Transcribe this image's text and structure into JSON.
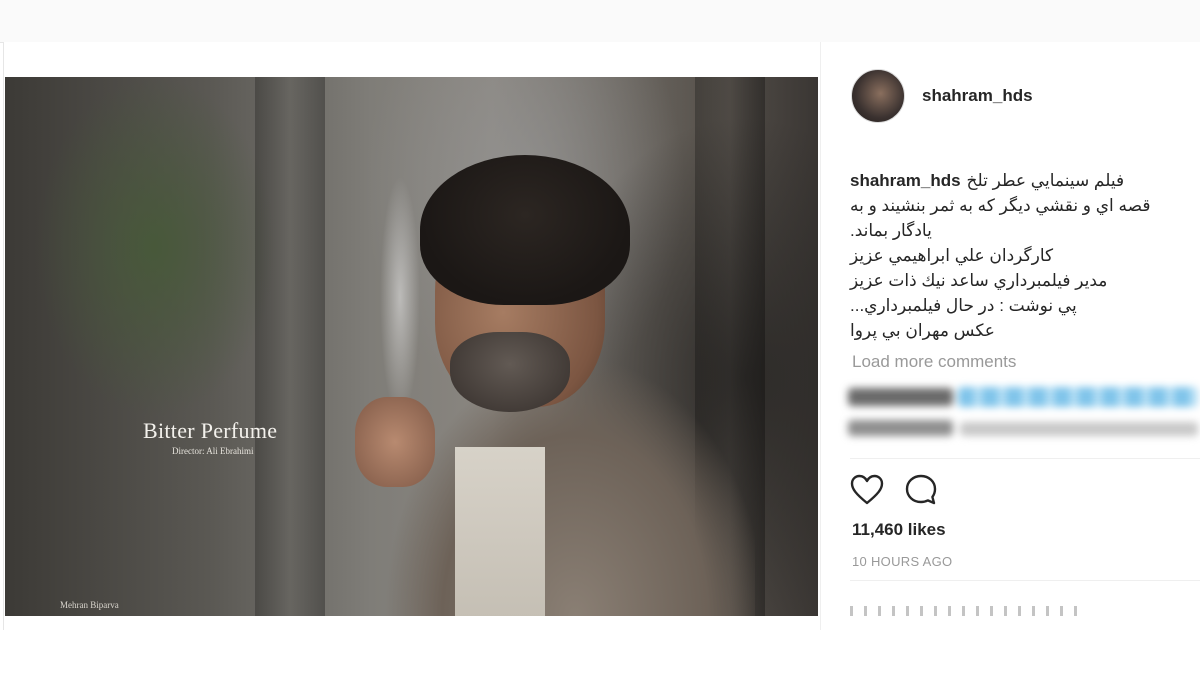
{
  "post": {
    "photo": {
      "title_text": "Bitter Perfume",
      "director_text": "Director: Ali Ebrahimi",
      "credit_text": "Mehran Biparva"
    },
    "header": {
      "username": "shahram_hds"
    },
    "caption": {
      "username": "shahram_hds",
      "lines": [
        "فيلم سينمايي عطر تلخ",
        "قصه اي و نقشي ديگر كه به ثمر بنشيند و به",
        "يادگار بماند.",
        "كارگردان علي ابراهيمي عزيز",
        "مدير فيلمبرداري ساعد نيك ذات عزيز",
        "پي نوشت : در حال فيلمبرداري...",
        "عكس مهران بي پروا"
      ]
    },
    "load_more_label": "Load more comments",
    "actions": {
      "like_icon": "heart-icon",
      "comment_icon": "comment-icon"
    },
    "likes_text": "11,460 likes",
    "time_ago_text": "10 HOURS AGO"
  }
}
